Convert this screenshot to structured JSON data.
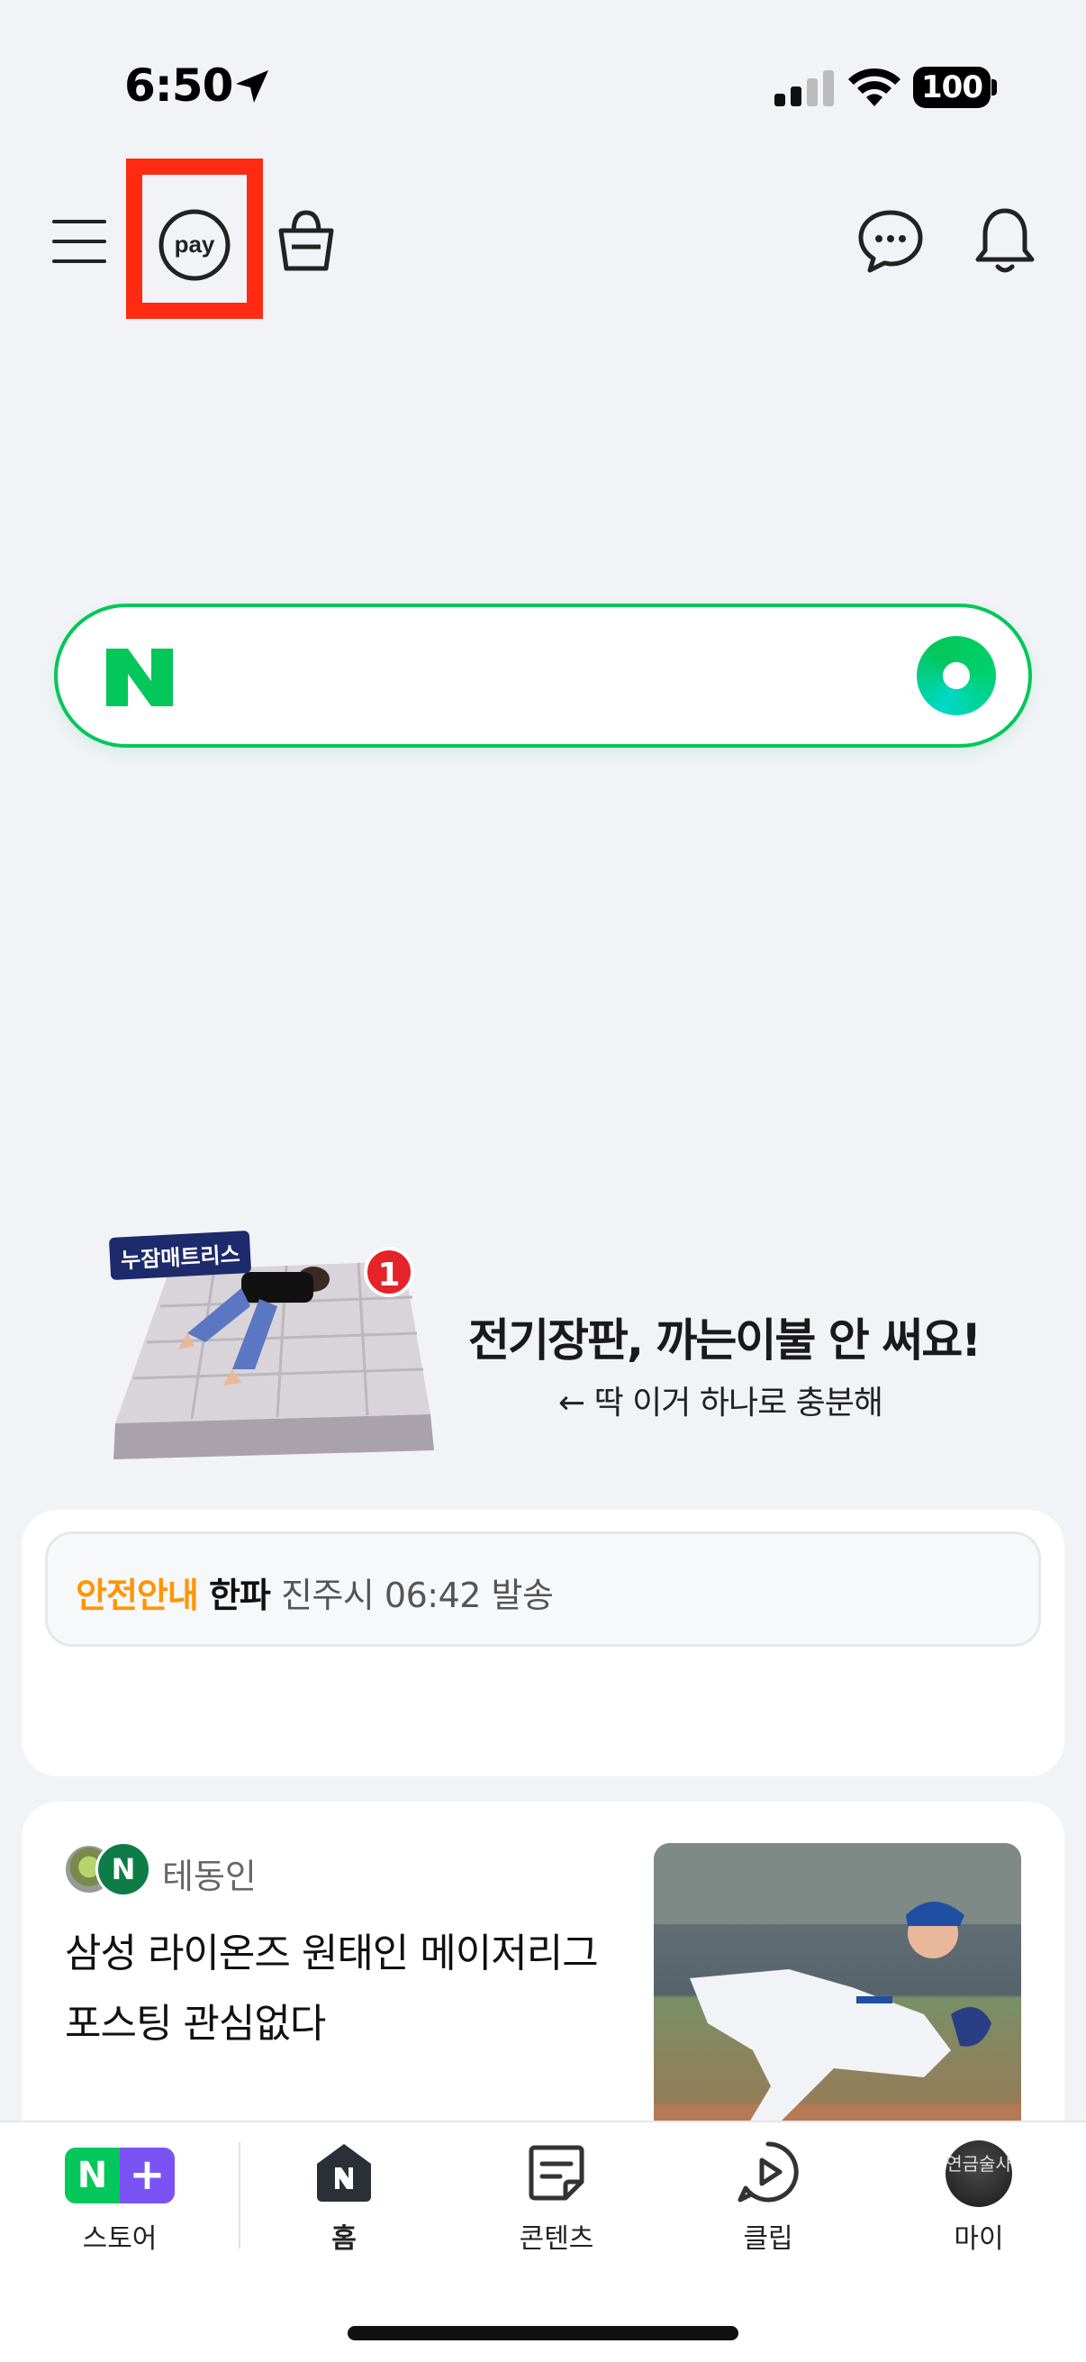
{
  "status_bar": {
    "time": "6:50",
    "battery": "100"
  },
  "top_nav": {
    "icons": [
      "menu-icon",
      "pay-icon",
      "shopping-bag-icon",
      "chat-icon",
      "bell-icon"
    ],
    "pay_label": "pay",
    "highlight_color": "#ff2a12"
  },
  "search": {
    "brand_color": "#03c75a"
  },
  "ad": {
    "brand_tag": "누잠매트리스",
    "badge": "1",
    "headline": "전기장판, 까는이불 안 써요!",
    "subtext": "← 딱 이거 하나로 충분해"
  },
  "safety": {
    "tag": "안전안내",
    "brand": "한파",
    "meta": "진주시 06:42 발송"
  },
  "news": {
    "source": "테동인",
    "title": "삼성 라이온즈 원태인 메이저리그 포스팅 관심없다"
  },
  "tabbar": {
    "tabs": [
      {
        "label": "스토어",
        "icon": "store-icon"
      },
      {
        "label": "홈",
        "icon": "home-icon"
      },
      {
        "label": "콘텐츠",
        "icon": "content-icon"
      },
      {
        "label": "클립",
        "icon": "clip-icon"
      },
      {
        "label": "마이",
        "icon": "profile-avatar"
      }
    ],
    "my_avatar_text": "연금술사"
  }
}
